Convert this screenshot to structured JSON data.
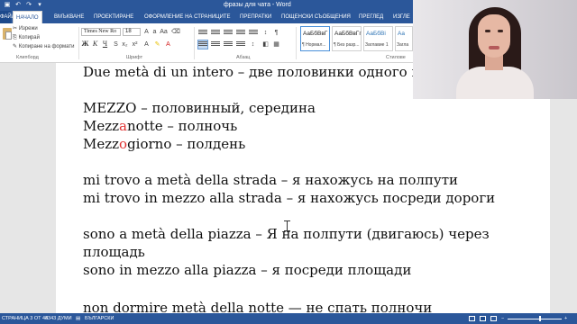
{
  "titlebar": {
    "quick_access": [
      "save-icon",
      "undo-icon",
      "redo-icon",
      "customize-icon"
    ],
    "title": "фразы для чата - Word"
  },
  "tabs": {
    "file": "ФАЙЛ",
    "items": [
      "НАЧАЛО",
      "ВМЪКВАНЕ",
      "ПРОЕКТИРАНЕ",
      "ОФОРМЛЕНИЕ НА СТРАНИЦИТЕ",
      "ПРЕПРАТКИ",
      "ПОЩЕНСКИ СЪОБЩЕНИЯ",
      "ПРЕГЛЕД",
      "ИЗГЛЕ"
    ]
  },
  "ribbon": {
    "clipboard": {
      "cut": "Изрежи",
      "copy": "Копирай",
      "format_painter": "Копиране на формати",
      "label": "Клипборд"
    },
    "font": {
      "name": "Times New Ro",
      "size": "18",
      "label": "Шрифт",
      "bold": "Ж",
      "italic": "К",
      "underline": "Ч"
    },
    "paragraph": {
      "label": "Абзац"
    },
    "styles": {
      "label": "Стилове",
      "items": [
        {
          "sample": "АаБбВвГ",
          "name": "¶ Нормал..."
        },
        {
          "sample": "АаБбВвГг",
          "name": "¶ Без разр..."
        },
        {
          "sample": "АаБбВі",
          "name": "Заглавие 1"
        },
        {
          "sample": "Аа",
          "name": "Загла"
        }
      ]
    }
  },
  "document": {
    "lines": [
      {
        "text": "Due metà di un intero – две половинки одного це..."
      },
      {
        "text": ""
      },
      {
        "text": "MEZZO – половинный, середина"
      },
      {
        "parts": [
          "Mezz",
          "a",
          "notte – полночь"
        ]
      },
      {
        "parts": [
          "Mezz",
          "o",
          "giorno – полдень"
        ]
      },
      {
        "text": ""
      },
      {
        "text": "mi trovo a metà della strada – я нахожусь на полпути"
      },
      {
        "text": "mi trovo in mezzo alla strada – я нахожусь посреди дороги"
      },
      {
        "text": ""
      },
      {
        "text": "sono a metà della piazza – Я на полпути  (двигаюсь) через"
      },
      {
        "text": "площадь"
      },
      {
        "text": "sono in mezzo alla piazza – я посреди площади"
      },
      {
        "text": ""
      },
      {
        "text": "non dormire metà della notte — не спать полночи"
      }
    ],
    "highlight_color": "#e03030"
  },
  "statusbar": {
    "page": "СТРАНИЦА 3 ОТ 44",
    "words": "8343 ДУМИ",
    "language": "БЪЛГАРСКИ"
  },
  "colors": {
    "brand": "#2b579a",
    "document_bg": "#e6e6e6"
  }
}
